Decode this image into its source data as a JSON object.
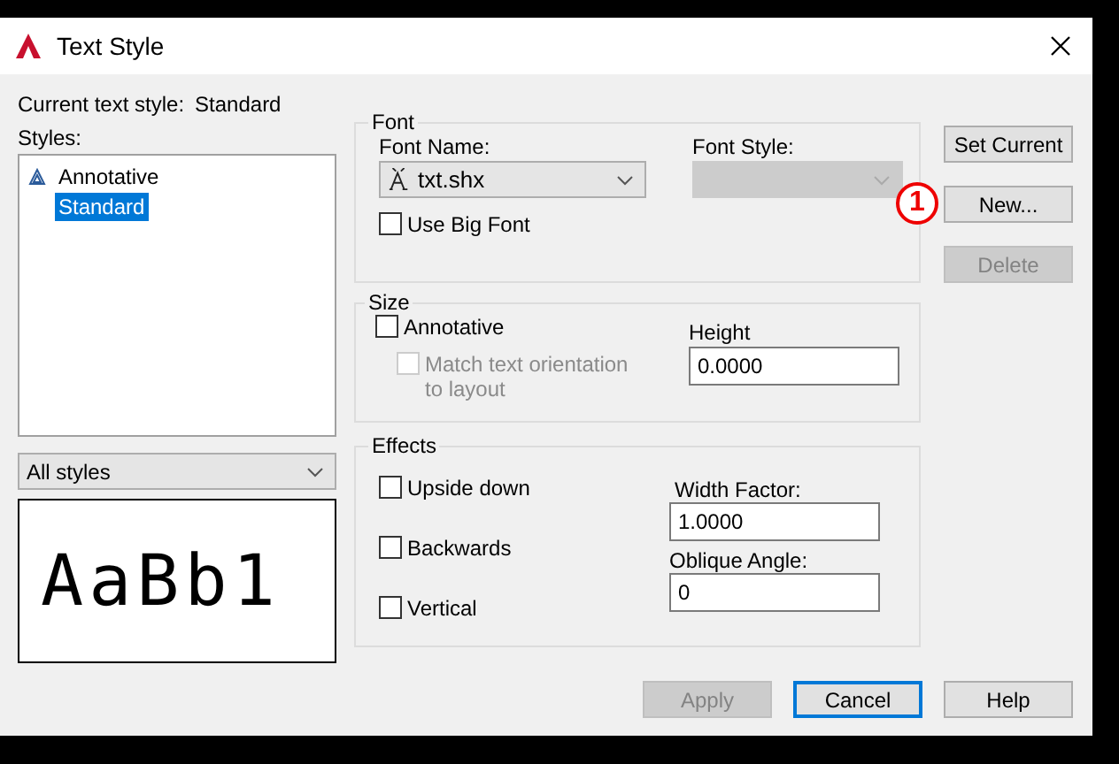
{
  "window": {
    "title": "Text Style"
  },
  "current_style": {
    "label": "Current text style:",
    "value": "Standard"
  },
  "styles": {
    "label": "Styles:",
    "items": [
      {
        "name": "Annotative",
        "kind": "annotative",
        "selected": false
      },
      {
        "name": "Standard",
        "kind": "plain",
        "selected": true
      }
    ]
  },
  "filter": {
    "value": "All styles"
  },
  "preview": {
    "text": "AaBb1"
  },
  "font": {
    "title": "Font",
    "font_name": {
      "label": "Font Name:",
      "value": "txt.shx"
    },
    "font_style": {
      "label": "Font Style:",
      "disabled": true
    },
    "use_big_font": {
      "label": "Use Big Font",
      "checked": false
    }
  },
  "size": {
    "title": "Size",
    "annotative": {
      "label": "Annotative",
      "checked": false
    },
    "match_orientation": {
      "label": "Match text orientation to layout",
      "checked": false,
      "disabled": true
    },
    "height": {
      "label": "Height",
      "value": "0.0000"
    }
  },
  "effects": {
    "title": "Effects",
    "options": [
      {
        "label": "Upside down",
        "checked": false
      },
      {
        "label": "Backwards",
        "checked": false
      },
      {
        "label": "Vertical",
        "checked": false
      }
    ],
    "width_factor": {
      "label": "Width Factor:",
      "value": "1.0000"
    },
    "oblique_angle": {
      "label": "Oblique Angle:",
      "value": "0"
    }
  },
  "side_buttons": [
    {
      "label": "Set Current",
      "disabled": false
    },
    {
      "label": "New...",
      "disabled": false
    },
    {
      "label": "Delete",
      "disabled": true
    }
  ],
  "annotation_marker": {
    "text": "1"
  },
  "bottom_buttons": [
    {
      "label": "Apply",
      "disabled": true,
      "focused": false
    },
    {
      "label": "Cancel",
      "disabled": false,
      "focused": true
    },
    {
      "label": "Help",
      "disabled": false,
      "focused": false
    }
  ]
}
